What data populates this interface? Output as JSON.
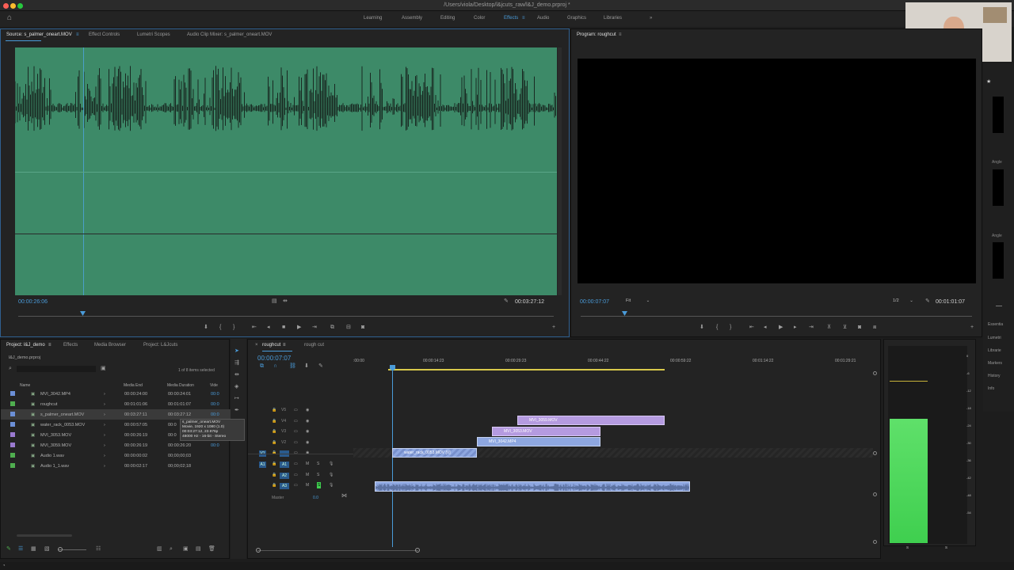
{
  "window": {
    "title": "/Users/viola/Desktop/l&jcuts_raw/l&J_demo.prproj *"
  },
  "workspaces": [
    {
      "label": "Learning",
      "active": false
    },
    {
      "label": "Assembly",
      "active": false
    },
    {
      "label": "Editing",
      "active": false
    },
    {
      "label": "Color",
      "active": false
    },
    {
      "label": "Effects",
      "active": true
    },
    {
      "label": "Audio",
      "active": false
    },
    {
      "label": "Graphics",
      "active": false
    },
    {
      "label": "Libraries",
      "active": false
    }
  ],
  "source": {
    "tabs": [
      "Source: s_palmer_oneart.MOV",
      "Effect Controls",
      "Lumetri Scopes",
      "Audio Clip Mixer: s_palmer_oneart.MOV"
    ],
    "timecode_left": "00:00:26:06",
    "timecode_right": "00:03:27:12",
    "waveform_color": "#3d8a68"
  },
  "program": {
    "title": "Program: roughcut",
    "timecode_left": "00:00:07:07",
    "fit": "Fit",
    "resolution": "1/2",
    "timecode_right": "00:01:01:07"
  },
  "right_strip": {
    "items": [
      "Essentia",
      "Lumetri",
      "Librarie",
      "Markers",
      "History",
      "Info"
    ],
    "angle_labels": [
      "Angle",
      "Angle"
    ]
  },
  "project": {
    "tabs": [
      "Project: l&J_demo",
      "Effects",
      "Media Browser",
      "Project: L&Jcuts"
    ],
    "filename": "l&J_demo.prproj",
    "selection_info": "1 of 8 items selected",
    "columns": [
      "Name",
      "Media End",
      "Media Duration",
      "Vide"
    ],
    "items": [
      {
        "name": "MVI_3042.MP4",
        "end": "00:00:24:00",
        "duration": "00:00:24:01",
        "video": "00:0",
        "color": "#6b8fd6",
        "sel": false
      },
      {
        "name": "roughcut",
        "end": "00:01:01:06",
        "duration": "00:01:01:07",
        "video": "00:0",
        "color": "#4fae4f",
        "sel": false
      },
      {
        "name": "s_palmer_oneart.MOV",
        "end": "00:03:27:11",
        "duration": "00:03:27:12",
        "video": "00:0",
        "color": "#6b8fd6",
        "sel": true
      },
      {
        "name": "water_rack_0053.MOV",
        "end": "00:00:57:05",
        "duration": "00:0",
        "video": "",
        "color": "#6b8fd6",
        "sel": false
      },
      {
        "name": "MVI_3053.MOV",
        "end": "00:00:26:19",
        "duration": "00:0",
        "video": "",
        "color": "#9a7ad0",
        "sel": false
      },
      {
        "name": "MVI_3059.MOV",
        "end": "00:00:26:19",
        "duration": "00:00:26:20",
        "video": "00:0",
        "color": "#9a7ad0",
        "sel": false
      },
      {
        "name": "Audio 1.wav",
        "end": "00:00:00:02",
        "duration": "00;00;00;03",
        "video": "",
        "color": "#4fae4f",
        "sel": false
      },
      {
        "name": "Audio 1_1.wav",
        "end": "00:00:02:17",
        "duration": "00;00;02;18",
        "video": "",
        "color": "#4fae4f",
        "sel": false
      }
    ],
    "tooltip": [
      "s_palmer_oneart.MOV",
      "Movie, 1920 x 1080 (1.0)",
      "00:03:27:12, 23.976p",
      "48000 Hz - 16-bit - Stereo"
    ]
  },
  "timeline": {
    "tabs": [
      "roughcut",
      "rough cut"
    ],
    "timecode": "00:00:07:07",
    "ruler": [
      ":00:00",
      "00:00:14:23",
      "00:00:29:23",
      "00:00:44:22",
      "00:00:59:22",
      "00:01:14:22",
      "00:01:29:21"
    ],
    "video_tracks": [
      "V5",
      "V4",
      "V3",
      "V2",
      "V1"
    ],
    "audio_tracks": [
      "A1",
      "A2",
      "A3"
    ],
    "master_label": "Master",
    "master_value": "0.0",
    "clips": {
      "v4": "MVI_3059.MOV",
      "v3": "MVI_3053.MOV",
      "v2": "MVI_3042.MP4",
      "v1": "water_rack_0053.MOV [V]"
    }
  },
  "meter": {
    "scale": [
      "0",
      "-6",
      "-12",
      "-18",
      "-24",
      "-30",
      "-36",
      "-42",
      "-48",
      "-54"
    ],
    "labels": [
      "S",
      "S"
    ],
    "color": "#3fcf4f"
  }
}
